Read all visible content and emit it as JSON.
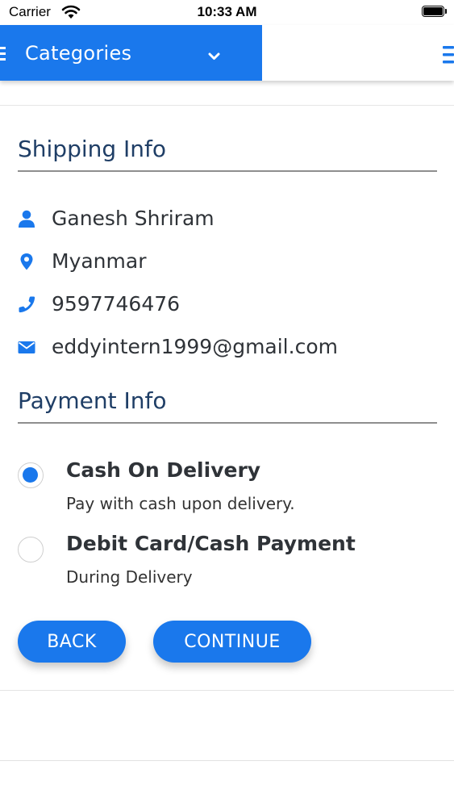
{
  "status_bar": {
    "carrier": "Carrier",
    "time": "10:33 AM"
  },
  "header": {
    "categories_label": "Categories",
    "accent_color": "#1a78ec"
  },
  "shipping": {
    "title": "Shipping Info",
    "name": "Ganesh Shriram",
    "location": "Myanmar",
    "phone": "9597746476",
    "email": "eddyintern1999@gmail.com"
  },
  "payment": {
    "title": "Payment Info",
    "options": [
      {
        "title": "Cash On Delivery",
        "subtitle": "Pay with cash upon delivery.",
        "selected": true
      },
      {
        "title": "Debit Card/Cash Payment",
        "subtitle": "During Delivery",
        "selected": false
      }
    ]
  },
  "buttons": {
    "back": "BACK",
    "continue": "CONTINUE"
  },
  "icons": {
    "name": "user-icon",
    "location": "map-pin-icon",
    "phone": "phone-icon",
    "email": "envelope-icon"
  }
}
